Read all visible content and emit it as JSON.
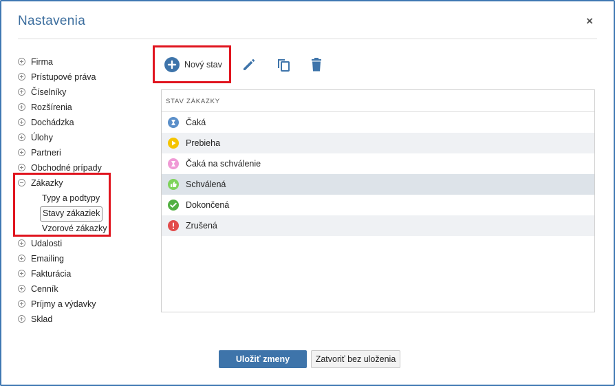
{
  "dialog": {
    "title": "Nastavenia",
    "close_label": "×"
  },
  "tree": {
    "items": [
      {
        "label": "Firma",
        "expanded": false
      },
      {
        "label": "Prístupové práva",
        "expanded": false
      },
      {
        "label": "Číselníky",
        "expanded": false
      },
      {
        "label": "Rozšírenia",
        "expanded": false
      },
      {
        "label": "Dochádzka",
        "expanded": false
      },
      {
        "label": "Úlohy",
        "expanded": false
      },
      {
        "label": "Partneri",
        "expanded": false
      },
      {
        "label": "Obchodné prípady",
        "expanded": false
      },
      {
        "label": "Zákazky",
        "expanded": true
      },
      {
        "label": "Udalosti",
        "expanded": false
      },
      {
        "label": "Emailing",
        "expanded": false
      },
      {
        "label": "Fakturácia",
        "expanded": false
      },
      {
        "label": "Cenník",
        "expanded": false
      },
      {
        "label": "Príjmy a výdavky",
        "expanded": false
      },
      {
        "label": "Sklad",
        "expanded": false
      }
    ],
    "subitems": [
      {
        "label": "Typy a podtypy",
        "selected": false
      },
      {
        "label": "Stavy zákaziek",
        "selected": true
      },
      {
        "label": "Vzorové zákazky",
        "selected": false
      }
    ]
  },
  "toolbar": {
    "new_label": "Nový stav",
    "icons": [
      "plus-circle-icon",
      "pencil-icon",
      "copy-icon",
      "trash-icon"
    ]
  },
  "table": {
    "header": "STAV ZÁKAZKY",
    "rows": [
      {
        "label": "Čaká",
        "icon": "hourglass-icon",
        "color": "#5b8fc9"
      },
      {
        "label": "Prebieha",
        "icon": "play-icon",
        "color": "#f5c400"
      },
      {
        "label": "Čaká na schválenie",
        "icon": "hourglass-icon",
        "color": "#f09ad6"
      },
      {
        "label": "Schválená",
        "icon": "thumbs-up-icon",
        "color": "#7ed35a"
      },
      {
        "label": "Dokončená",
        "icon": "check-icon",
        "color": "#52b043"
      },
      {
        "label": "Zrušená",
        "icon": "exclamation-icon",
        "color": "#e24b4b"
      }
    ]
  },
  "footer": {
    "save_label": "Uložiť zmeny",
    "cancel_label": "Zatvoriť bez uloženia"
  },
  "colors": {
    "accent": "#3e74aa",
    "highlight": "#e0141e"
  }
}
